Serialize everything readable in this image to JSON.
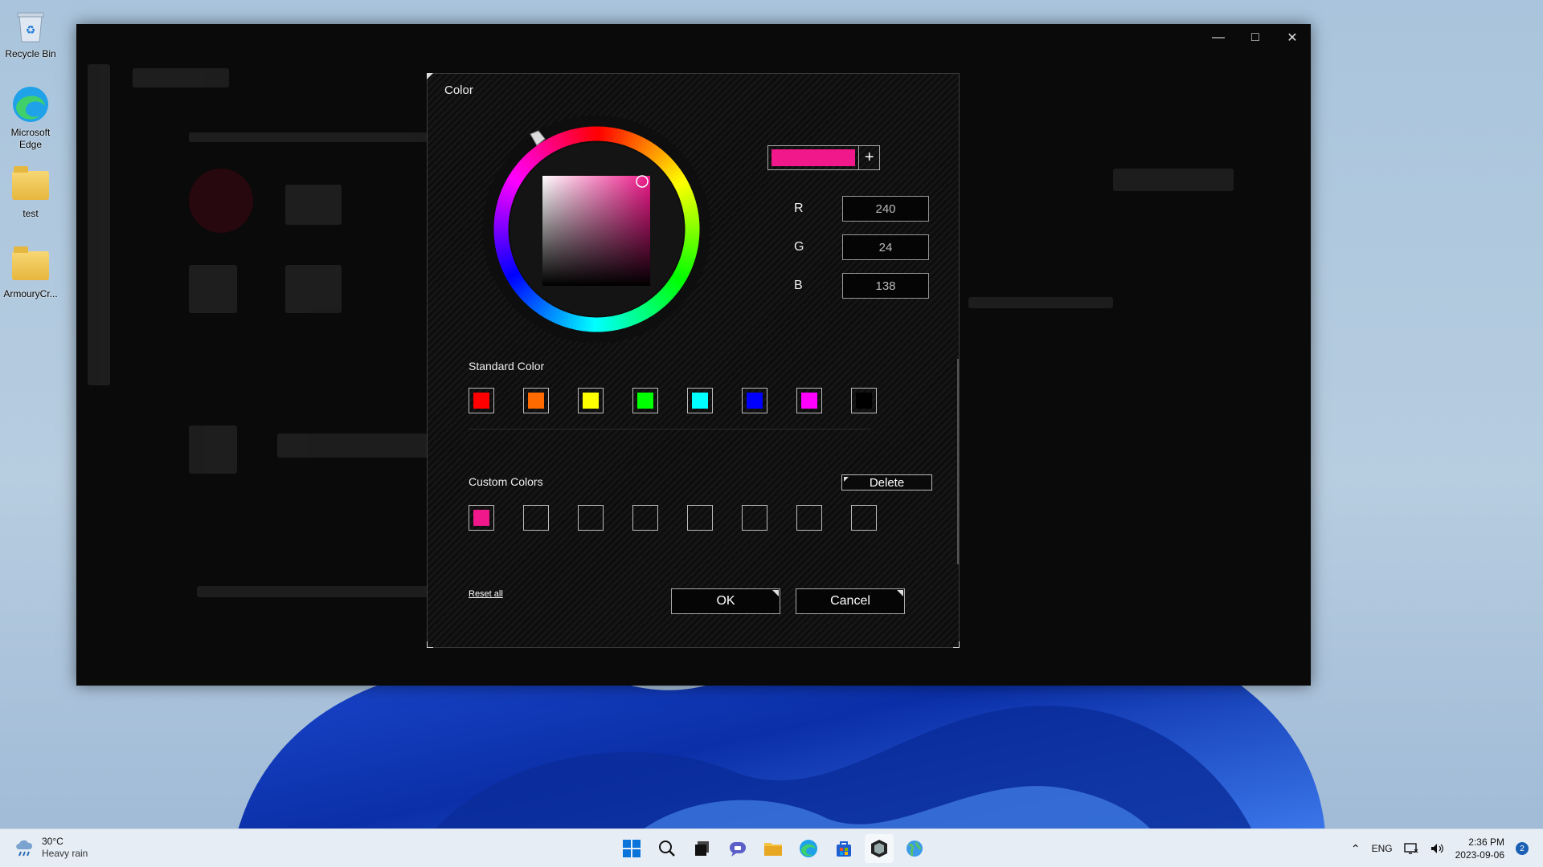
{
  "desktop": {
    "icons": [
      {
        "label": "Recycle Bin"
      },
      {
        "label": "Microsoft Edge"
      },
      {
        "label": "test"
      },
      {
        "label": "ArmouryCr..."
      }
    ]
  },
  "dialog": {
    "title": "Color",
    "current_color": "#f0188a",
    "add_button": "+",
    "r_label": "R",
    "r_value": "240",
    "g_label": "G",
    "g_value": "24",
    "b_label": "B",
    "b_value": "138",
    "standard_label": "Standard Color",
    "standard_colors": [
      "#ff0000",
      "#ff6a00",
      "#ffff00",
      "#00ff00",
      "#00ffff",
      "#0000ff",
      "#ff00ff",
      "#000000"
    ],
    "custom_label": "Custom Colors",
    "custom_colors": [
      "#f0188a",
      "",
      "",
      "",
      "",
      "",
      "",
      ""
    ],
    "delete_label": "Delete",
    "reset_label": "Reset all",
    "ok_label": "OK",
    "cancel_label": "Cancel"
  },
  "taskbar": {
    "temperature": "30°C",
    "weather": "Heavy rain",
    "language": "ENG",
    "time": "2:36 PM",
    "date": "2023-09-06",
    "notification_count": "2"
  }
}
